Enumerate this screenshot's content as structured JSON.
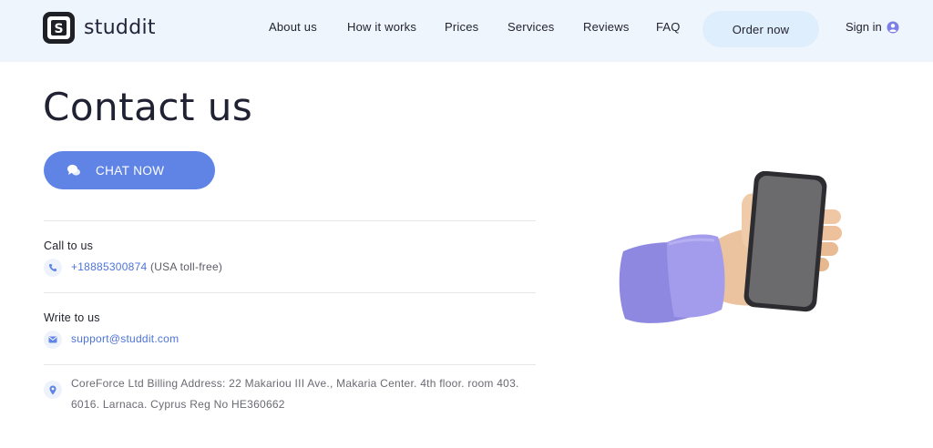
{
  "brand": {
    "name": "studdit",
    "logo_letter": "S"
  },
  "nav": {
    "items": [
      "About us",
      "How it works",
      "Prices",
      "Services",
      "Reviews",
      "FAQ"
    ],
    "order_label": "Order now",
    "signin_label": "Sign in"
  },
  "main": {
    "title": "Contact us",
    "chat_label": "CHAT NOW",
    "call": {
      "title": "Call to us",
      "phone": "+18885300874",
      "phone_note": "(USA toll-free)"
    },
    "write": {
      "title": "Write to us",
      "email": "support@studdit.com"
    },
    "address": {
      "line1": "CoreForce Ltd Billing Address: 22 Makariou III Ave., Makaria Center. 4th floor. room 403.",
      "line2": "6016. Larnaca. Cyprus Reg No HE360662"
    }
  },
  "icons": {
    "logo": "studdit-logo-icon",
    "signin": "user-circle-icon",
    "chat": "chat-bubbles-icon",
    "phone": "phone-icon",
    "email": "envelope-icon",
    "address": "map-pin-icon"
  },
  "colors": {
    "header_bg": "#eef5fd",
    "accent": "#5f84e6",
    "link": "#4c74d8",
    "order_button_bg": "#dfeefc",
    "title": "#202233"
  }
}
